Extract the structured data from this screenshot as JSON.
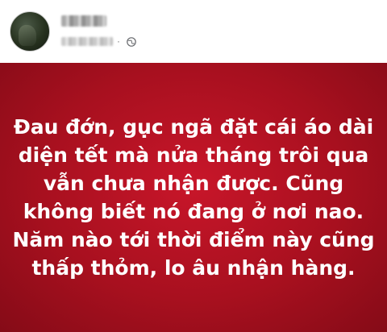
{
  "post": {
    "author_name": "",
    "timestamp": "",
    "privacy_icon": "globe-icon",
    "text": "Đau đớn, gục ngã đặt cái áo dài diện tết mà nửa tháng trôi qua vẫn chưa nhận được. Cũng không biết nó đang ở nơi nao. Năm nào tới thời điểm này cũng thấp thỏm, lo âu nhận hàng.",
    "background_color": "#b3111f",
    "text_color": "#ffffff"
  }
}
